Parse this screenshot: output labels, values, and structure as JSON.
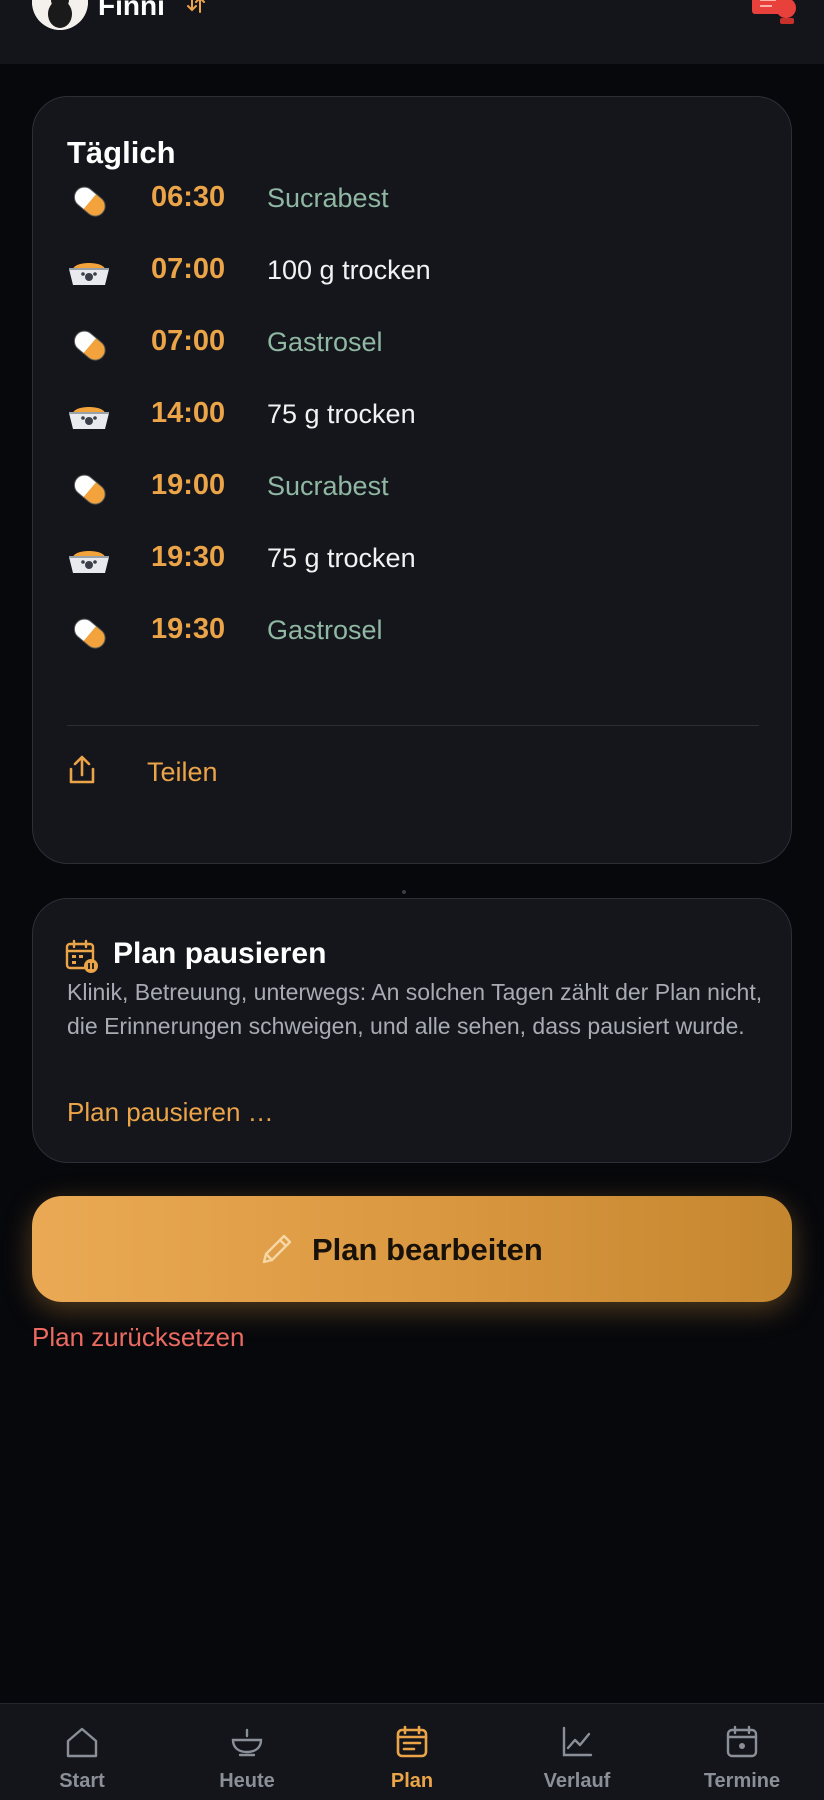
{
  "header": {
    "pet_name": "Finni"
  },
  "daily": {
    "title": "Täglich",
    "items": [
      {
        "type": "med",
        "icon": "pill-icon",
        "time": "06:30",
        "label": "Sucrabest"
      },
      {
        "type": "food",
        "icon": "food-bowl-icon",
        "time": "07:00",
        "label": "100 g trocken"
      },
      {
        "type": "med",
        "icon": "pill-icon",
        "time": "07:00",
        "label": "Gastrosel"
      },
      {
        "type": "food",
        "icon": "food-bowl-icon",
        "time": "14:00",
        "label": "75 g trocken"
      },
      {
        "type": "med",
        "icon": "pill-icon",
        "time": "19:00",
        "label": "Sucrabest"
      },
      {
        "type": "food",
        "icon": "food-bowl-icon",
        "time": "19:30",
        "label": "75 g trocken"
      },
      {
        "type": "med",
        "icon": "pill-icon",
        "time": "19:30",
        "label": "Gastrosel"
      }
    ],
    "share_label": "Teilen"
  },
  "pause": {
    "title": "Plan pausieren",
    "description": "Klinik, Betreuung, unterwegs: An solchen Tagen zählt der Plan nicht, die Erinnerungen schweigen, und alle sehen, dass pausiert wurde.",
    "link_label": "Plan pausieren …"
  },
  "actions": {
    "edit_label": "Plan bearbeiten",
    "reset_label": "Plan zurücksetzen"
  },
  "nav": [
    {
      "label": "Start",
      "icon": "home-icon",
      "active": false
    },
    {
      "label": "Heute",
      "icon": "bowl-icon",
      "active": false
    },
    {
      "label": "Plan",
      "icon": "plan-icon",
      "active": true
    },
    {
      "label": "Verlauf",
      "icon": "chart-icon",
      "active": false
    },
    {
      "label": "Termine",
      "icon": "calendar-icon",
      "active": false
    }
  ],
  "colors": {
    "accent": "#eba447",
    "med_text": "#8fb7a2",
    "danger": "#ec6b61",
    "background": "#07080c",
    "card": "#14161c"
  }
}
